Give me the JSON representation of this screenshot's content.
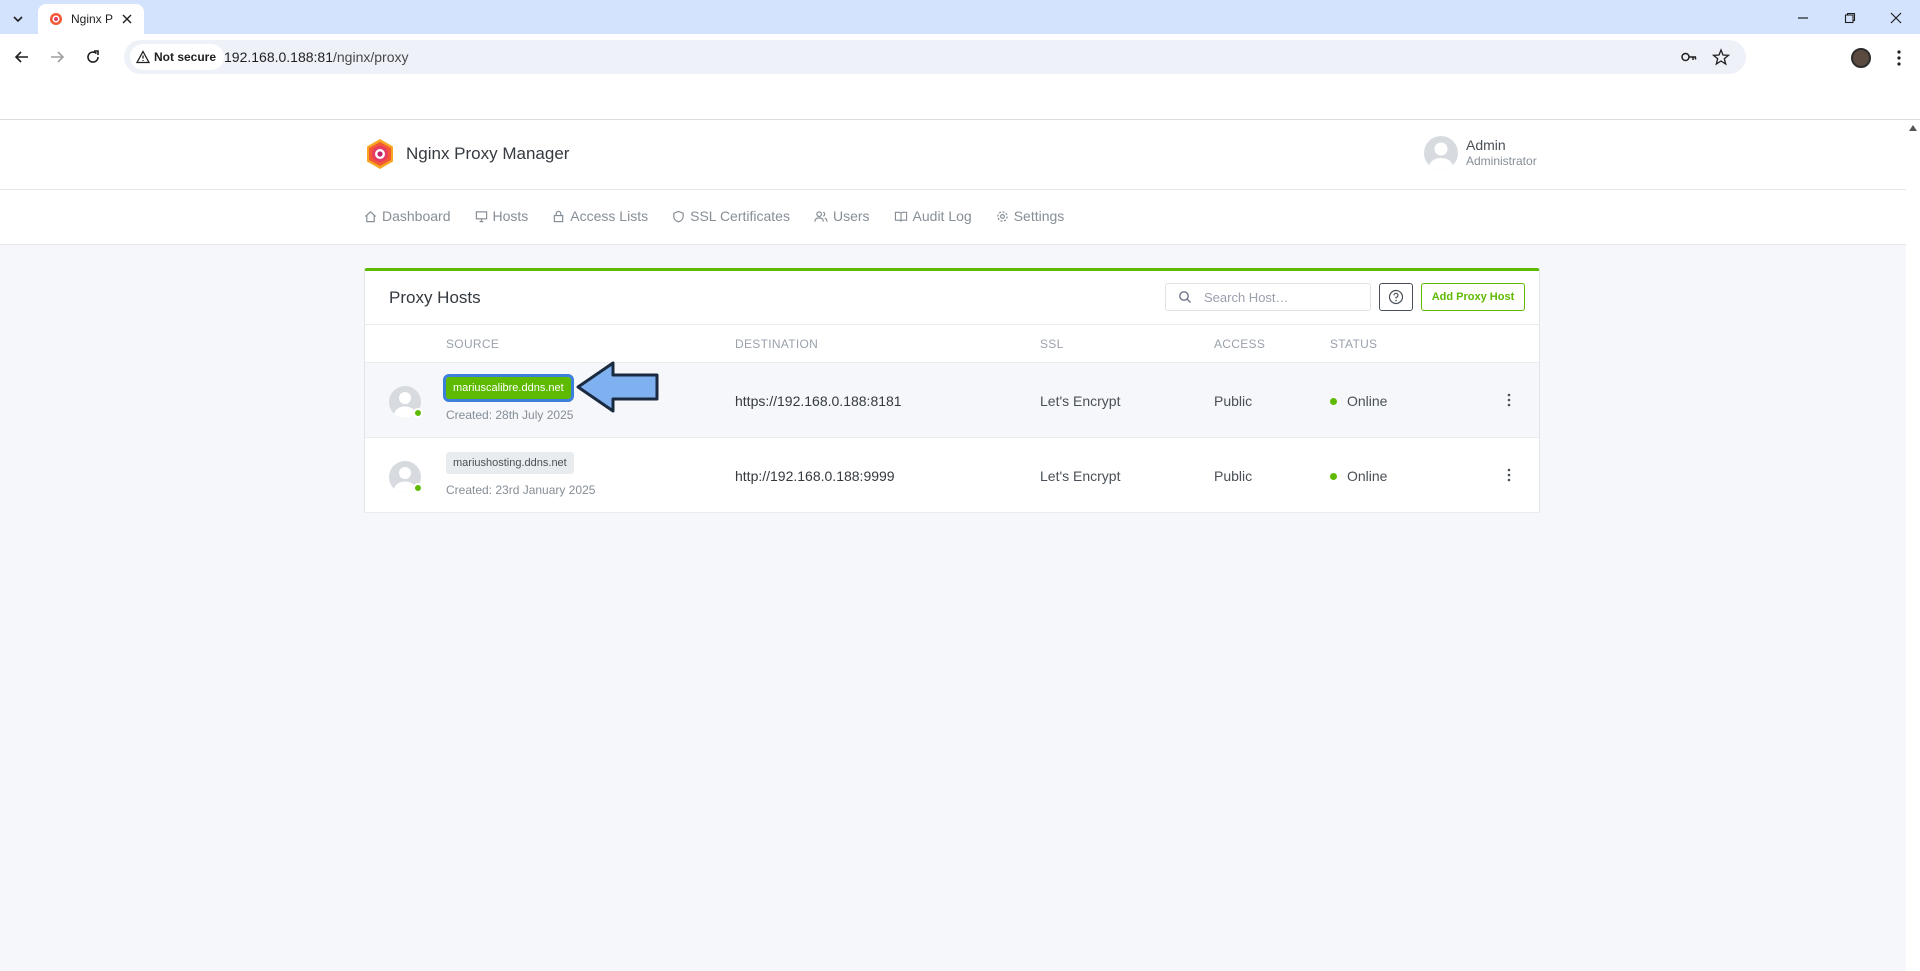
{
  "browser": {
    "tab_title": "Nginx P",
    "security_label": "Not secure",
    "url_host": "192.168.0.188:81",
    "url_path": "/nginx/proxy"
  },
  "app": {
    "brand": "Nginx Proxy Manager",
    "user_name": "Admin",
    "user_role": "Administrator"
  },
  "nav": {
    "items": [
      {
        "label": "Dashboard",
        "icon": "home-icon"
      },
      {
        "label": "Hosts",
        "icon": "monitor-icon"
      },
      {
        "label": "Access Lists",
        "icon": "lock-icon"
      },
      {
        "label": "SSL Certificates",
        "icon": "shield-icon"
      },
      {
        "label": "Users",
        "icon": "users-icon"
      },
      {
        "label": "Audit Log",
        "icon": "book-icon"
      },
      {
        "label": "Settings",
        "icon": "gear-icon"
      }
    ]
  },
  "proxy_hosts": {
    "title": "Proxy Hosts",
    "search_placeholder": "Search Host…",
    "add_button": "Add Proxy Host",
    "columns": [
      "SOURCE",
      "DESTINATION",
      "SSL",
      "ACCESS",
      "STATUS"
    ],
    "rows": [
      {
        "domain": "mariuscalibre.ddns.net",
        "created": "Created: 28th July 2025",
        "destination": "https://192.168.0.188:8181",
        "ssl": "Let's Encrypt",
        "access": "Public",
        "status": "Online"
      },
      {
        "domain": "mariushosting.ddns.net",
        "created": "Created: 23rd January 2025",
        "destination": "http://192.168.0.188:9999",
        "ssl": "Let's Encrypt",
        "access": "Public",
        "status": "Online"
      }
    ]
  },
  "colors": {
    "accent_green": "#5eba00",
    "highlight_blue": "#3b7fd8",
    "arrow_fill": "#7fb0f0"
  }
}
